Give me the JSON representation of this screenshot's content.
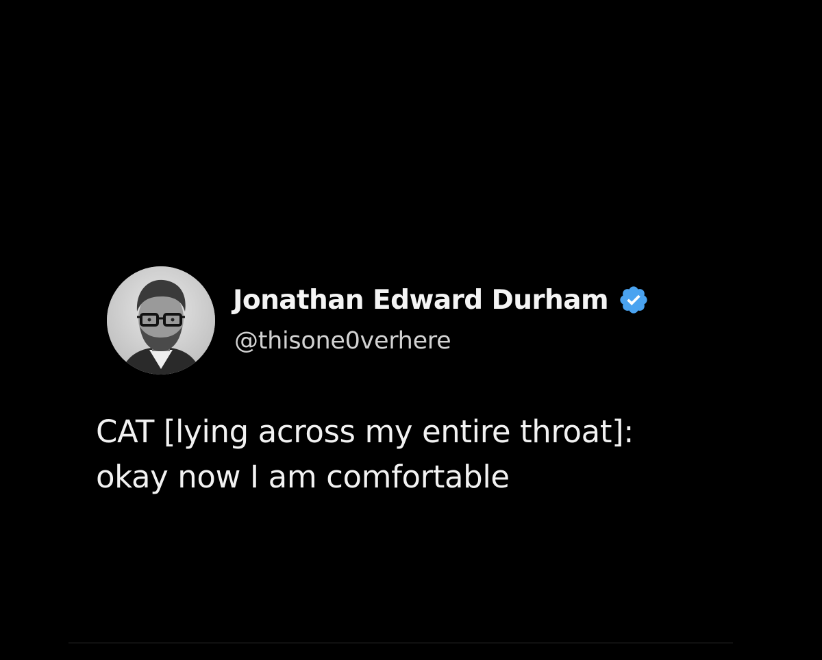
{
  "tweet": {
    "author": {
      "display_name": "Jonathan Edward Durham",
      "handle": "@thisone0verhere",
      "verified": true,
      "avatar_icon": "profile-photo",
      "verified_icon": "verified-badge-icon"
    },
    "text_lines": [
      "CAT [lying across my entire throat]:",
      "okay now I am comfortable"
    ]
  },
  "colors": {
    "background": "#000000",
    "text": "#f2f2f2",
    "handle": "#d2d2d2",
    "verified_badge": "#4aa3f0"
  }
}
